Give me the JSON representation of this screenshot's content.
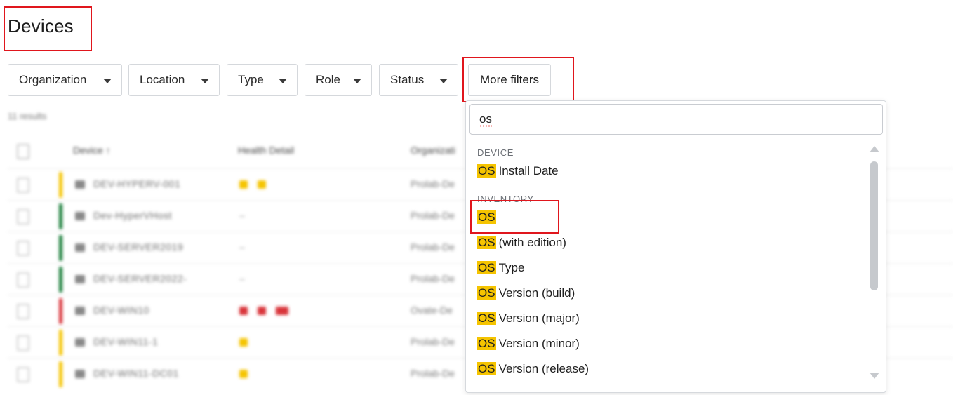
{
  "header": {
    "title": "Devices"
  },
  "filters": [
    {
      "label": "Organization"
    },
    {
      "label": "Location"
    },
    {
      "label": "Type"
    },
    {
      "label": "Role"
    },
    {
      "label": "Status"
    }
  ],
  "more_filters": {
    "label": "More filters"
  },
  "table": {
    "results": "11 results",
    "columns": [
      "Device ↑",
      "Health Detail",
      "Organizati"
    ],
    "rows": [
      {
        "status_color": "#f5c400",
        "name": "DEV-HYPERV-001",
        "health": "",
        "org": "Prolab-De"
      },
      {
        "status_color": "#1b7f3b",
        "name": "Dev-HyperVHost",
        "health": "–",
        "org": "Prolab-De"
      },
      {
        "status_color": "#1b7f3b",
        "name": "DEV-SERVER2019",
        "health": "–",
        "org": "Prolab-De"
      },
      {
        "status_color": "#1b7f3b",
        "name": "DEV-SERVER2022-",
        "health": "–",
        "org": "Prolab-De"
      },
      {
        "status_color": "#d9353b",
        "name": "DEV-WIN10",
        "health": "",
        "org": "Ovate-De"
      },
      {
        "status_color": "#f5c400",
        "name": "DEV-WIN11-1",
        "health": "",
        "org": "Prolab-De"
      },
      {
        "status_color": "#f5c400",
        "name": "DEV-WIN11-DC01",
        "health": "",
        "org": "Prolab-De"
      }
    ]
  },
  "dropdown": {
    "search_value": "os",
    "sections": [
      {
        "title": "DEVICE",
        "items": [
          {
            "match": "OS",
            "rest": "Install Date"
          }
        ]
      },
      {
        "title": "INVENTORY",
        "items": [
          {
            "match": "OS",
            "rest": ""
          },
          {
            "match": "OS",
            "rest": "(with edition)"
          },
          {
            "match": "OS",
            "rest": "Type"
          },
          {
            "match": "OS",
            "rest": "Version (build)"
          },
          {
            "match": "OS",
            "rest": "Version (major)"
          },
          {
            "match": "OS",
            "rest": "Version (minor)"
          },
          {
            "match": "OS",
            "rest": "Version (release)"
          }
        ]
      }
    ]
  },
  "colors": {
    "highlight": "#f5c400",
    "annotation": "#e0161d",
    "warning": "#f5c400",
    "ok": "#1b7f3b",
    "error": "#d9353b"
  }
}
